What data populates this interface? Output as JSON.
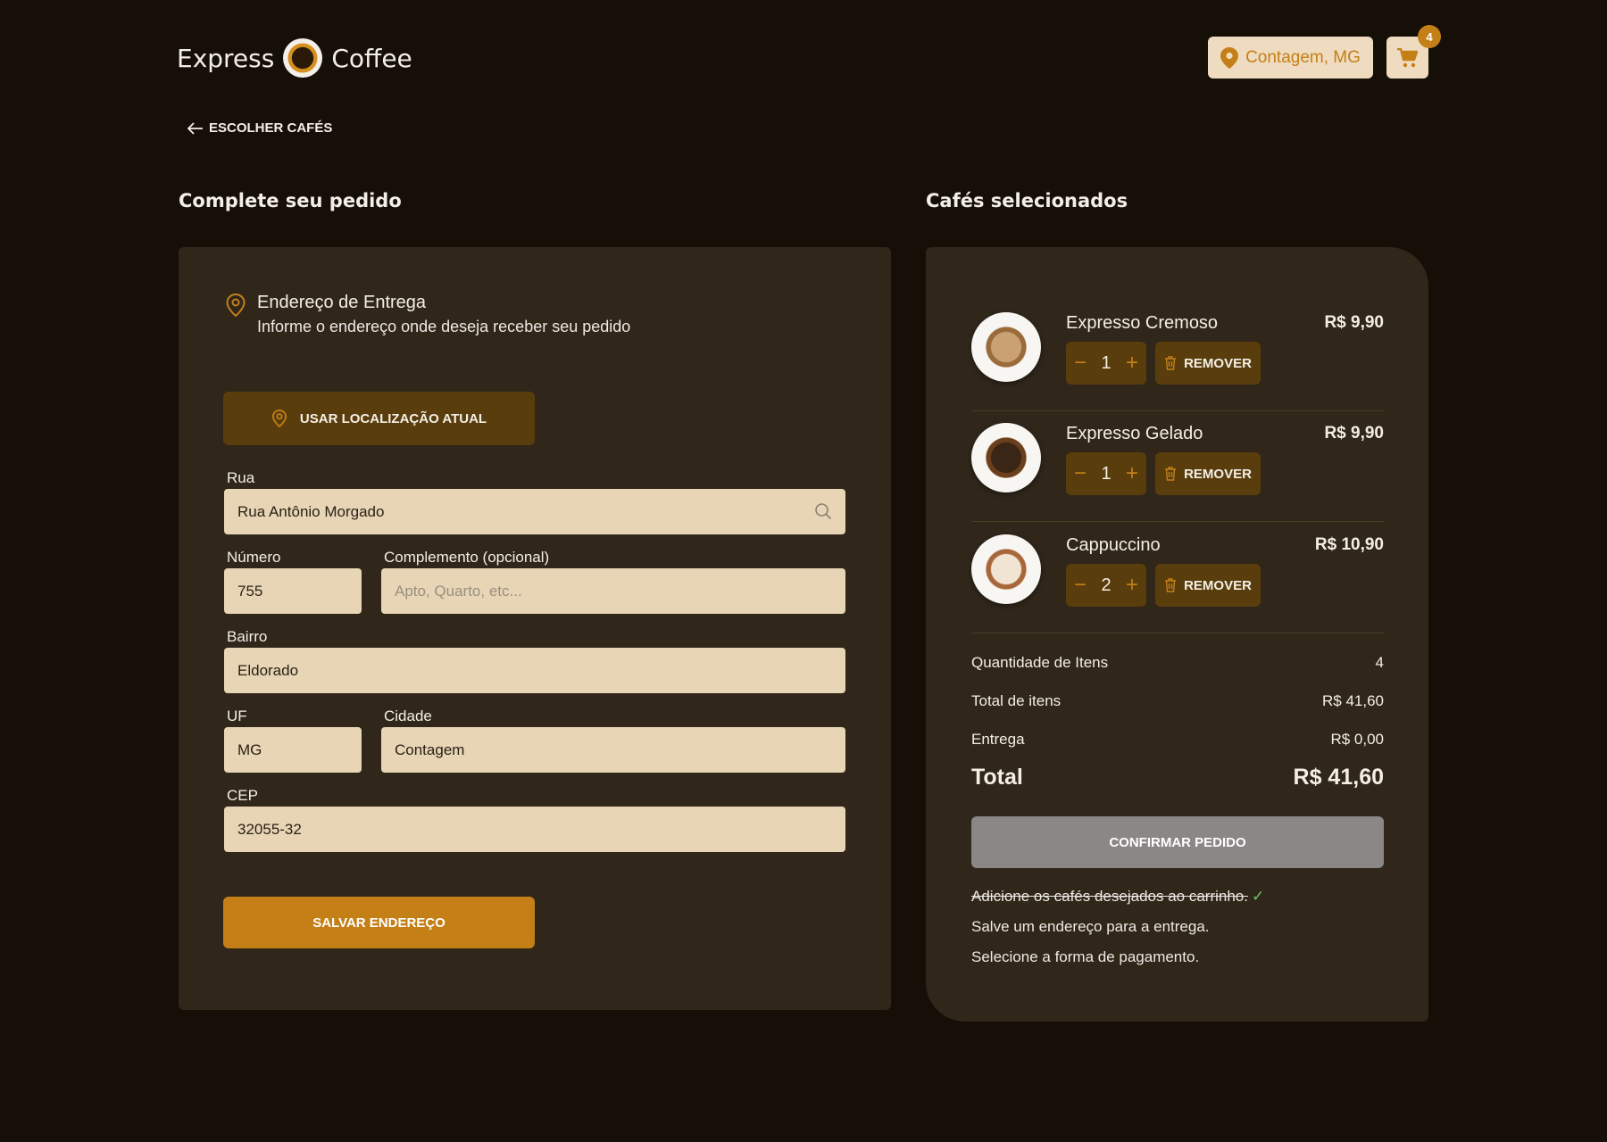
{
  "header": {
    "logo_left": "Express",
    "logo_right": "Coffee",
    "location": "Contagem, MG",
    "cart_count": "4"
  },
  "nav": {
    "back_label": "ESCOLHER CAFÉS"
  },
  "form": {
    "section_title": "Complete seu pedido",
    "address_title": "Endereço de Entrega",
    "address_subtitle": "Informe o endereço onde deseja receber seu pedido",
    "use_location_label": "USAR LOCALIZAÇÃO ATUAL",
    "fields": {
      "rua": {
        "label": "Rua",
        "value": "Rua Antônio Morgado"
      },
      "numero": {
        "label": "Número",
        "value": "755"
      },
      "complemento": {
        "label": "Complemento (opcional)",
        "value": "",
        "placeholder": "Apto, Quarto, etc..."
      },
      "bairro": {
        "label": "Bairro",
        "value": "Eldorado"
      },
      "uf": {
        "label": "UF",
        "value": "MG"
      },
      "cidade": {
        "label": "Cidade",
        "value": "Contagem"
      },
      "cep": {
        "label": "CEP",
        "value": "32055-32"
      }
    },
    "save_label": "SALVAR ENDEREÇO"
  },
  "cart": {
    "section_title": "Cafés selecionados",
    "items": [
      {
        "name": "Expresso Cremoso",
        "price": "R$ 9,90",
        "qty": "1",
        "remove_label": "REMOVER"
      },
      {
        "name": "Expresso Gelado",
        "price": "R$ 9,90",
        "qty": "1",
        "remove_label": "REMOVER"
      },
      {
        "name": "Cappuccino",
        "price": "R$ 10,90",
        "qty": "2",
        "remove_label": "REMOVER"
      }
    ],
    "summary": {
      "qty_label": "Quantidade de Itens",
      "qty_value": "4",
      "items_total_label": "Total de itens",
      "items_total_value": "R$ 41,60",
      "delivery_label": "Entrega",
      "delivery_value": "R$ 0,00",
      "total_label": "Total",
      "total_value": "R$ 41,60"
    },
    "confirm_label": "CONFIRMAR PEDIDO",
    "checklist": [
      "Adicione os cafés desejados ao carrinho.",
      "Salve um endereço para a entrega.",
      "Selecione a forma de pagamento."
    ]
  },
  "colors": {
    "background": "#160f08",
    "card": "#30261a",
    "accent": "#c47f17",
    "accent_dark": "#5a3d0c",
    "input_bg": "#e8d5b5",
    "disabled": "#8b8787",
    "success": "#6ec46e"
  }
}
